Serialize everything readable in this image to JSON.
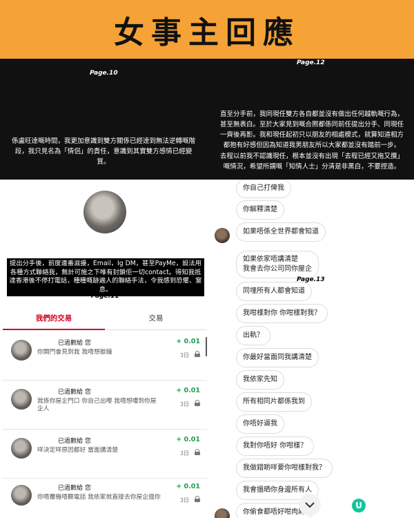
{
  "header": {
    "title": "女事主回應"
  },
  "page10": {
    "label": "Page.10",
    "text": "係盧旺達嘅時間，我更加意識到雙方關係已經達到無法逆轉嘅階段，我只見名為「情侶」的責任，意識到其實雙方感情已經變質。"
  },
  "page12": {
    "label": "Page.12",
    "text1": "直至分手前，我同現任雙方各自都並沒有做出任何越軌嘅行為，甚至無表白。至於大家見到嘅合照都係同前任提出分手、同現任一齊後再影。我和現任起初只以朋友的相處模式，就算知道相方都抱有好感但因為知道我男朋友所以大家都並沒有踏前一步。",
    "text2": "去程以前我不認識現任，根本並沒有出現「去程已經又拖又攬」嘅情況，希望所謂嘅「知情人士」分清是非黑白，不要捏造。"
  },
  "page11": {
    "label": "Page.11",
    "notice": "提出分手後，前度連番滋擾，Email，Ig DM，甚至PayMe，設法用各種方式聯絡我，無計可施之下唯有封鎖佢一切contact。得知我抵達香港後不停打電話，種種嘅跡遍人的聯絡手法，令我感到恐懼、窒息。",
    "tabs": [
      "我們的交易",
      "交易"
    ],
    "transactions": [
      {
        "title": "已過數給 您",
        "message": "你開門會見到我 我唔想撳鐘",
        "amount": "+ 0.01",
        "date": "3日"
      },
      {
        "title": "已過數給 您",
        "message": "我係你屋企門口 你自己出嚟 我唔想嘈到你屋企人",
        "amount": "+ 0.01",
        "date": "3日"
      },
      {
        "title": "已過數給 您",
        "message": "咩決定咩原因都好 當面講清楚",
        "amount": "+ 0.01",
        "date": "3日"
      },
      {
        "title": "已過數給 您",
        "message": "你唔覆機唔聽電話 我依家就直接去你屋企搵你",
        "amount": "+ 0.01",
        "date": "3日"
      }
    ]
  },
  "page13": {
    "label": "Page.13",
    "messages": [
      "你自己打俾我",
      "你解釋清楚",
      "如果唔係全世界都會知道",
      "如果依家唔講清楚\n我會去你公司同你屋企",
      "同埋所有人都會知道",
      "我咁樣對你 你咁樣對我？",
      "出軌？",
      "你最好當面同我講清楚",
      "我依家先知",
      "所有相同片都係我到",
      "你唔好逼我",
      "我對你唔好 你咁樣？",
      "我做錯啲咩要你咁樣對我？",
      "我會搵晒你身邊所有人",
      "你偷食都唔好咁肉麻"
    ],
    "brand": "U"
  },
  "icons": [
    "down-chevron-icon",
    "lock-icon",
    "brand-u-logo"
  ],
  "colors": {
    "header_bg": "#f5a236",
    "accent_red": "#d0021b",
    "amount_green": "#1f9d55"
  }
}
